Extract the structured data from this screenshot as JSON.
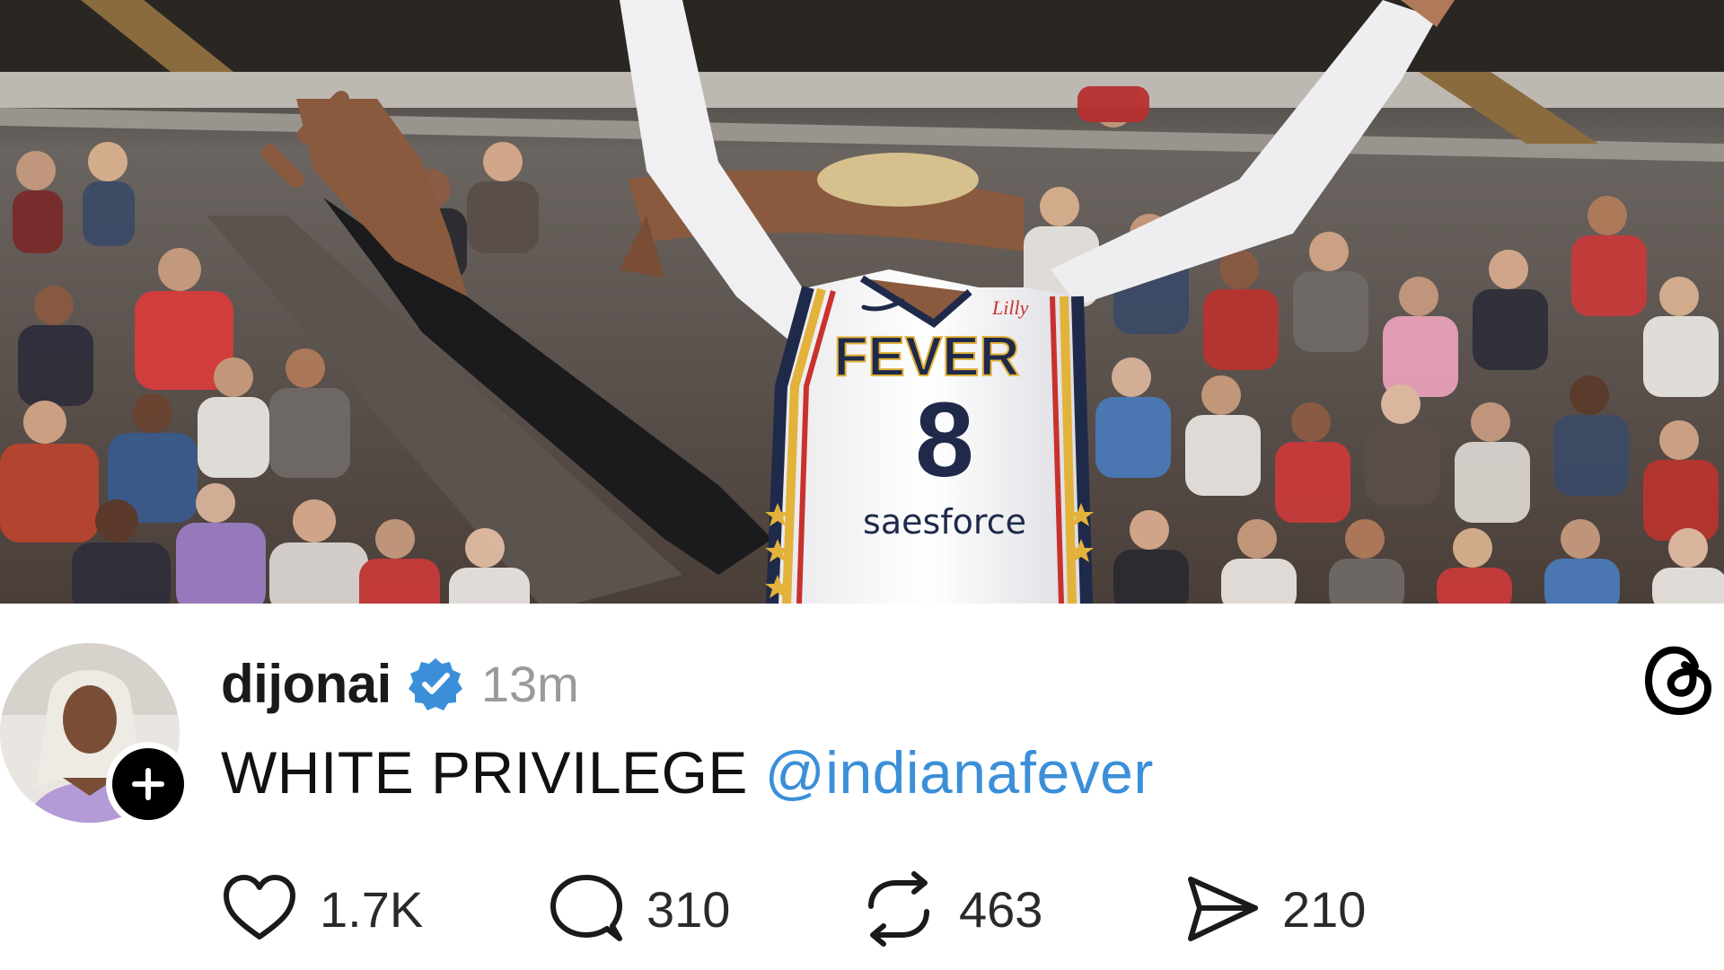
{
  "photo": {
    "jersey_team": "FEVER",
    "jersey_number": "8",
    "jersey_sponsor": "saesforce",
    "jersey_collar_text": "Lilly"
  },
  "post": {
    "username": "dijonai",
    "timestamp": "13m",
    "text": "WHITE PRIVILEGE",
    "mention": "@indianafever",
    "icons": {
      "verified": "verified-badge-icon",
      "follow": "plus-icon",
      "app": "threads-logo-icon",
      "like": "heart-icon",
      "reply": "speech-bubble-icon",
      "repost": "repost-arrows-icon",
      "share": "send-paper-plane-icon"
    },
    "colors": {
      "mention": "#3b8fd9",
      "verified": "#3b8fd9",
      "timestamp": "#9a9a9a"
    }
  },
  "actions": {
    "likes": "1.7K",
    "replies": "310",
    "reposts": "463",
    "shares": "210"
  }
}
